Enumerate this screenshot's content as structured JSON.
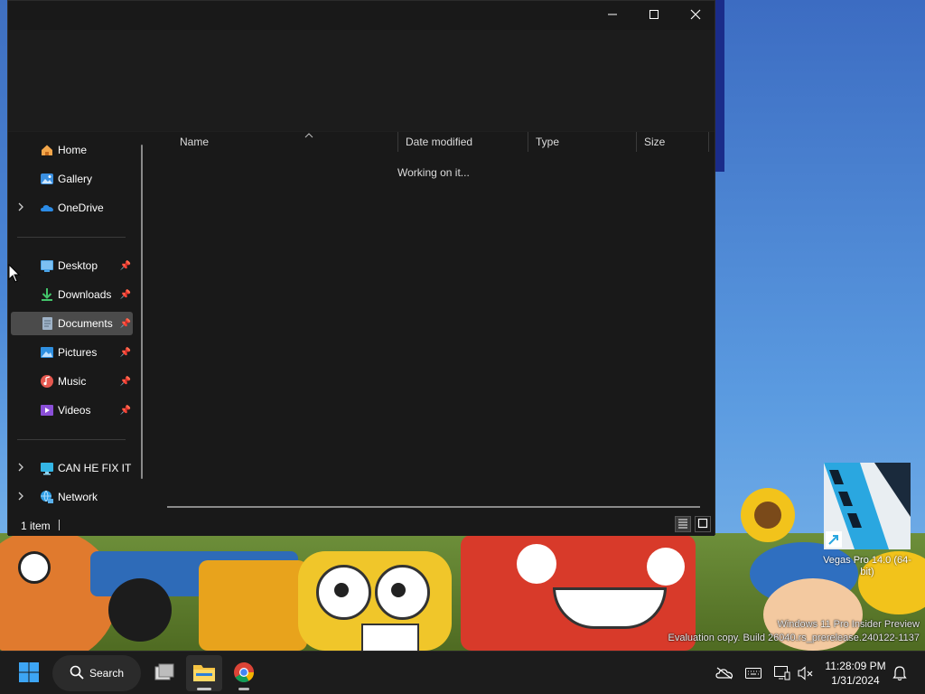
{
  "window": {
    "minimize_icon": "minimize-icon",
    "maximize_icon": "maximize-icon",
    "close_icon": "close-icon"
  },
  "navigation": {
    "items": [
      {
        "label": "Home",
        "icon": "home-icon"
      },
      {
        "label": "Gallery",
        "icon": "gallery-icon"
      },
      {
        "label": "OneDrive",
        "icon": "onedrive-cloud-icon",
        "expandable": true
      },
      {
        "label": "Desktop",
        "icon": "desktop-folder-icon",
        "pinned": true
      },
      {
        "label": "Downloads",
        "icon": "downloads-icon",
        "pinned": true
      },
      {
        "label": "Documents",
        "icon": "documents-icon",
        "pinned": true,
        "selected": true
      },
      {
        "label": "Pictures",
        "icon": "pictures-icon",
        "pinned": true
      },
      {
        "label": "Music",
        "icon": "music-icon",
        "pinned": true
      },
      {
        "label": "Videos",
        "icon": "videos-icon",
        "pinned": true
      },
      {
        "label": "CAN HE FIX IT",
        "icon": "computer-icon",
        "expandable": true
      },
      {
        "label": "Network",
        "icon": "network-icon",
        "expandable": true
      }
    ]
  },
  "content": {
    "columns": [
      "Name",
      "Date modified",
      "Type",
      "Size"
    ],
    "sorted_column": "Name",
    "status_message": "Working on it..."
  },
  "statusbar": {
    "item_count": "1 item"
  },
  "desktop": {
    "icon_label": "Vegas Pro 14.0 (64-bit)",
    "watermark_line1": "Windows 11 Pro Insider Preview",
    "watermark_line2": "Evaluation copy. Build 26040.rs_prerelease.240122-1137"
  },
  "taskbar": {
    "search_label": "Search",
    "time": "11:28:09 PM",
    "date": "1/31/2024",
    "pinned": [
      "start-icon",
      "taskview-icon",
      "file-explorer-icon",
      "chrome-icon"
    ],
    "tray": [
      "onedrive-tray-icon",
      "keyboard-icon",
      "display-icon",
      "volume-muted-icon",
      "notification-bell-icon"
    ]
  },
  "colors": {
    "window_bg": "#191919",
    "selected_nav": "#4b4b4b",
    "taskbar_bg": "#1c1c1c"
  }
}
